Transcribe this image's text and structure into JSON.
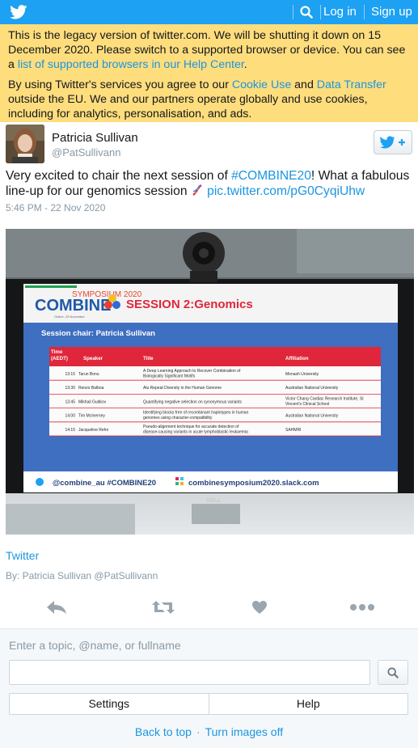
{
  "header": {
    "logo_icon": "twitter-bird-icon",
    "search_icon": "search-icon",
    "login_label": "Log in",
    "signup_label": "Sign up",
    "brand_color": "#1da1f2"
  },
  "notice": {
    "line1_prefix": "This is the legacy version of twitter.com. We will be shutting it down on 15 December 2020. Please switch to a supported browser or device. You can see a ",
    "line1_link": "list of supported browsers in our Help Center",
    "line1_suffix": ".",
    "line2_prefix": "By using Twitter's services you agree to our ",
    "cookie_link": "Cookie Use",
    "line2_and": " and ",
    "transfer_link": "Data Transfer",
    "line2_suffix": " outside the EU. We and our partners operate globally and use cookies, including for analytics, personalisation, and ads.",
    "background": "#fedd7d"
  },
  "tweet": {
    "fullname": "Patricia Sullivan",
    "username": "@PatSullivann",
    "follow_icon": "follow-bird-plus-icon",
    "text_prefix": "Very excited to chair the next session of ",
    "hashtag": "#COMBINE20",
    "text_middle": "! What a fabulous line-up for our genomics session ",
    "emoji_icon": "dna-icon",
    "pic_link": "pic.twitter.com/pG0CyqiUhw",
    "timestamp": "5:46 PM - 22 Nov 2020"
  },
  "photo": {
    "symposium_label": "SYMPOSIUM 2020",
    "logo_text": "COMBINE",
    "logo_date": "Online, 23 November",
    "session_title": "SESSION 2:Genomics",
    "session_chair": "Session chair:  Patricia Sullivan",
    "table_headers": [
      "Time (AEDT)",
      "Speaker",
      "Title",
      "Affiliation"
    ],
    "table_rows": [
      [
        "13:15",
        "Tarun Bonu",
        "A Deep Learning Approach to Recover Combination of Biologically Significant Motifs",
        "Monash University"
      ],
      [
        "13:30",
        "Renzo Balboa",
        "Alu Repeat Diversity in the Human Genome",
        "Australian National University"
      ],
      [
        "13:45",
        "Mikhail Gudkov",
        "Quantifying negative selection on synonymous variants",
        "Victor Chang Cardiac Research Institute, St Vincent's Clinical School"
      ],
      [
        "14:00",
        "Tim McInerney",
        "Identifying blocks free of recombinant haplotypes in human genomes using character-compatibility",
        "Australian National University"
      ],
      [
        "14:15",
        "Jacqueline Rehn",
        "Pseudo-alignment technique for accurate detection of disease-causing variants in acute lymphoblastic leukaemia",
        "SAHMRI"
      ]
    ],
    "footer_twitter": "@combine_au #COMBINE20",
    "footer_slack": "combinesymposium2020.slack.com",
    "monitor_brand": "DELL"
  },
  "card": {
    "title": "Twitter",
    "by_prefix": "By: ",
    "by_name": "Patricia Sullivan",
    "by_handle": "@PatSullivann"
  },
  "actions": {
    "reply_icon": "reply-icon",
    "retweet_icon": "retweet-icon",
    "like_icon": "heart-icon",
    "more_icon": "more-dots-icon"
  },
  "footer": {
    "search_label": "Enter a topic, @name, or fullname",
    "search_value": "",
    "search_placeholder": "",
    "settings_label": "Settings",
    "help_label": "Help",
    "back_to_top": "Back to top",
    "separator": "·",
    "turn_images_off": "Turn images off"
  }
}
